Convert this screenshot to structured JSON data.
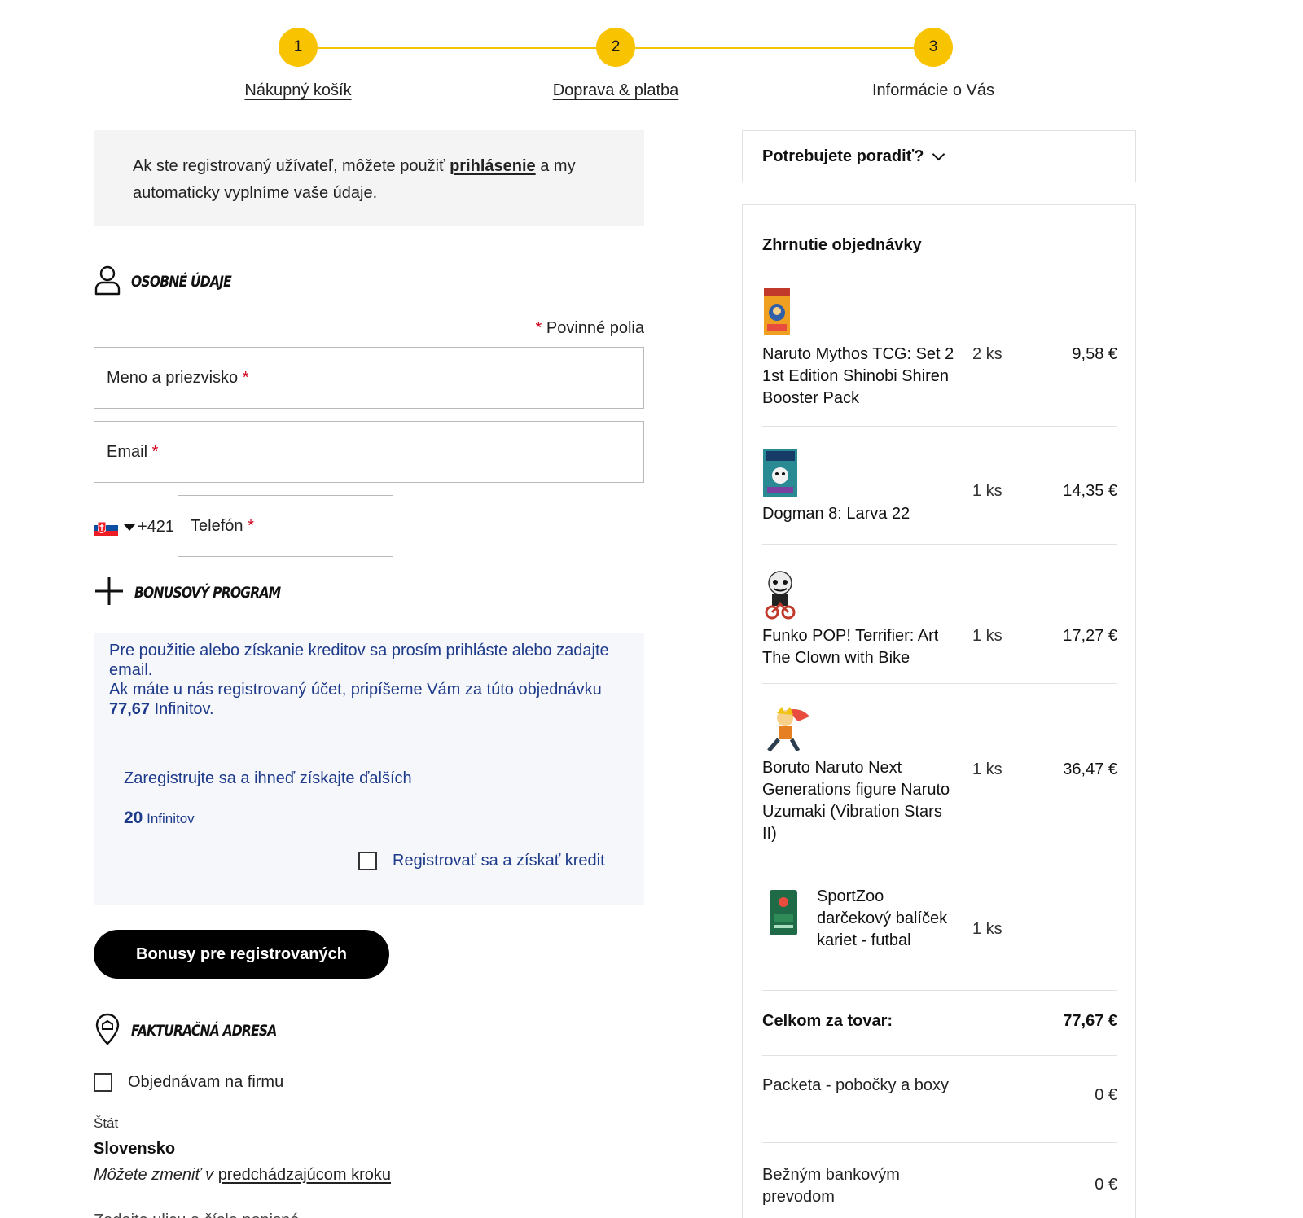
{
  "stepper": {
    "steps": [
      {
        "number": "1",
        "label": "Nákupný košík"
      },
      {
        "number": "2",
        "label": "Doprava & platba"
      },
      {
        "number": "3",
        "label": "Informácie o Vás"
      }
    ]
  },
  "login_notice": {
    "text_before": "Ak ste registrovaný užívateľ, môžete použiť ",
    "link": "prihlásenie",
    "text_after": " a my automaticky vyplníme vaše údaje."
  },
  "personal": {
    "title": "Osobné údaje",
    "required_star": "*",
    "required_note": "Povinné polia",
    "name_placeholder": "Meno a priezvisko",
    "email_placeholder": "Email",
    "phone_prefix": "+421",
    "phone_placeholder": "Telefón"
  },
  "bonus": {
    "title": "Bonusový program",
    "line1": "Pre použitie alebo získanie kreditov sa prosím prihláste alebo zadajte email.",
    "line2_before": "Ak máte u nás registrovaný účet, pripíšeme Vám za túto objednávku ",
    "line2_amount": "77,67",
    "line2_after": " Infinitov.",
    "register_text": "Zaregistrujte sa a ihneď získajte ďalších",
    "register_amount": "20",
    "register_unit": "Infinitov",
    "checkbox_label": "Registrovať sa a získať kredit",
    "button": "Bonusy pre registrovaných"
  },
  "billing": {
    "title": "Fakturačná adresa",
    "company_checkbox": "Objednávam na firmu",
    "state_label": "Štát",
    "state_value": "Slovensko",
    "hint_before": "Môžete zmeniť v ",
    "hint_link": "predchádzajúcom kroku",
    "cut_text": "Zadajte ulicu a číslo popisné"
  },
  "help": {
    "label": "Potrebujete poradiť?"
  },
  "summary": {
    "title": "Zhrnutie objednávky",
    "items": [
      {
        "name": "Naruto Mythos TCG: Set 2 1st Edition Shinobi Shiren Booster Pack",
        "qty": "2 ks",
        "price": "9,58 €"
      },
      {
        "name": "Dogman 8: Larva 22",
        "qty": "1 ks",
        "price": "14,35 €"
      },
      {
        "name": "Funko POP! Terrifier: Art The Clown with Bike",
        "qty": "1 ks",
        "price": "17,27 €"
      },
      {
        "name": "Boruto Naruto Next Generations figure Naruto Uzumaki (Vibration Stars II)",
        "qty": "1 ks",
        "price": "36,47 €"
      },
      {
        "name": "SportZoo darčekový balíček kariet - futbal",
        "qty": "1 ks",
        "price": ""
      }
    ],
    "total_label": "Celkom za tovar:",
    "total_value": "77,67 €",
    "shipping_label": "Packeta - pobočky a boxy",
    "shipping_value": "0 €",
    "payment_label": "Bežným bankovým prevodom",
    "payment_value": "0 €"
  },
  "colors": {
    "accent": "#f8c300",
    "bonus_text": "#1e3a8a",
    "required": "#d0021b"
  }
}
